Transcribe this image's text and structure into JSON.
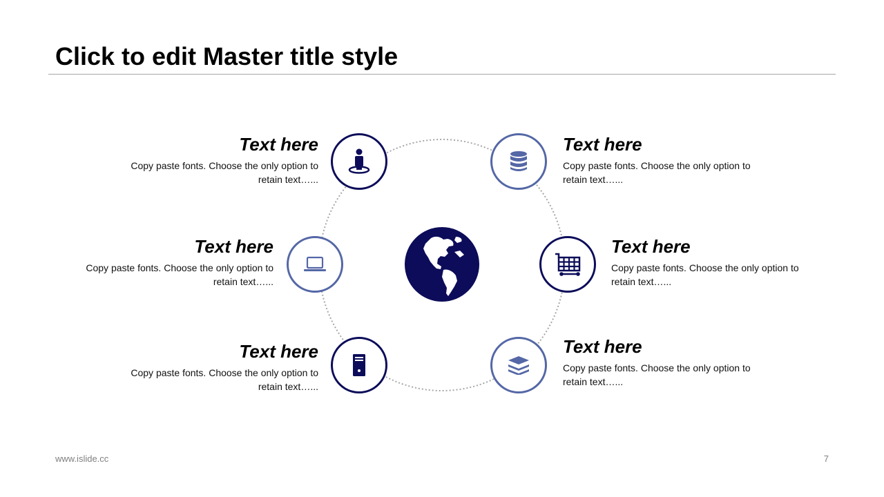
{
  "slide": {
    "title": "Click to edit Master title style",
    "footer_url": "www.islide.cc",
    "page_number": "7"
  },
  "colors": {
    "dark_navy": "#0c0c5a",
    "light_blue": "#5467a6",
    "rule_gray": "#a6a6a6",
    "dotted_gray": "#a6a6a6"
  },
  "center": {
    "icon": "globe-americas-icon"
  },
  "items": [
    {
      "heading": "Text here",
      "body": "Copy paste fonts. Choose the only option to retain text…...",
      "icon": "person-standing-on-spot-icon"
    },
    {
      "heading": "Text here",
      "body": "Copy paste fonts. Choose the only option to retain text…...",
      "icon": "database-icon"
    },
    {
      "heading": "Text here",
      "body": "Copy paste fonts. Choose the only option to retain text…...",
      "icon": "laptop-icon"
    },
    {
      "heading": "Text here",
      "body": "Copy paste fonts. Choose the only option to retain text…...",
      "icon": "shopping-cart-icon"
    },
    {
      "heading": "Text here",
      "body": "Copy paste fonts. Choose the only option to retain text…...",
      "icon": "server-tower-icon"
    },
    {
      "heading": "Text here",
      "body": "Copy paste fonts. Choose the only option to retain text…...",
      "icon": "layers-stack-icon"
    }
  ]
}
